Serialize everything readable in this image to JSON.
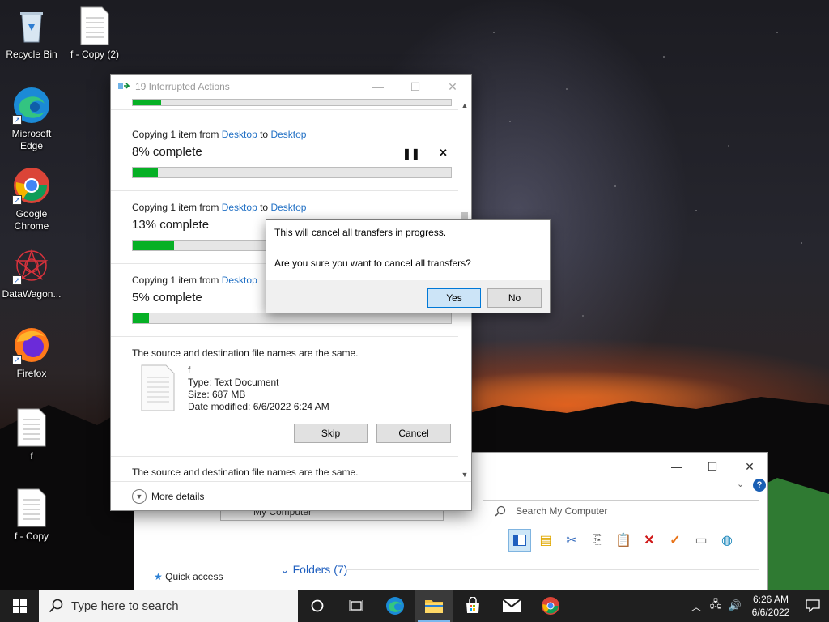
{
  "desktop": {
    "icons": [
      {
        "label": "Recycle Bin"
      },
      {
        "label": "f - Copy (2)"
      },
      {
        "label": "Microsoft Edge"
      },
      {
        "label": "Google Chrome"
      },
      {
        "label": "DataWagon..."
      },
      {
        "label": "Firefox"
      },
      {
        "label": "f"
      },
      {
        "label": "f - Copy"
      }
    ]
  },
  "progress_window": {
    "title": "19 Interrupted Actions",
    "items": [
      {
        "prefix": "Copying 1 item from ",
        "from": "Desktop",
        "mid": " to ",
        "to": "Desktop",
        "percent_text": "8% complete",
        "progress": 0.08
      },
      {
        "prefix": "Copying 1 item from ",
        "from": "Desktop",
        "mid": " to ",
        "to": "Desktop",
        "percent_text": "13% complete",
        "progress": 0.13
      },
      {
        "prefix": "Copying 1 item from ",
        "from": "Desktop",
        "mid": "",
        "to": "",
        "percent_text": "5% complete",
        "progress": 0.05
      }
    ],
    "top_partial_progress": 0.09,
    "conflict": {
      "message": "The source and destination file names are the same.",
      "file_name": "f",
      "type": "Type: Text Document",
      "size": "Size: 687 MB",
      "modified": "Date modified: 6/6/2022 6:24 AM",
      "skip_label": "Skip",
      "cancel_label": "Cancel"
    },
    "conflict_next_message": "The source and destination file names are the same.",
    "more_details_label": "More details"
  },
  "confirm_dialog": {
    "line1": "This will cancel all transfers in progress.",
    "line2": "Are you sure you want to cancel all transfers?",
    "yes_label": "Yes",
    "no_label": "No"
  },
  "explorer": {
    "address": "My Computer",
    "search_placeholder": "Search My Computer",
    "quick_access": "Quick access",
    "folders_header": "Folders (7)"
  },
  "taskbar": {
    "search_placeholder": "Type here to search",
    "time": "6:26 AM",
    "date": "6/6/2022"
  },
  "colors": {
    "progress_green": "#06b025",
    "link_blue": "#1f6fc4",
    "taskbar_bg": "#1f1f1f"
  }
}
